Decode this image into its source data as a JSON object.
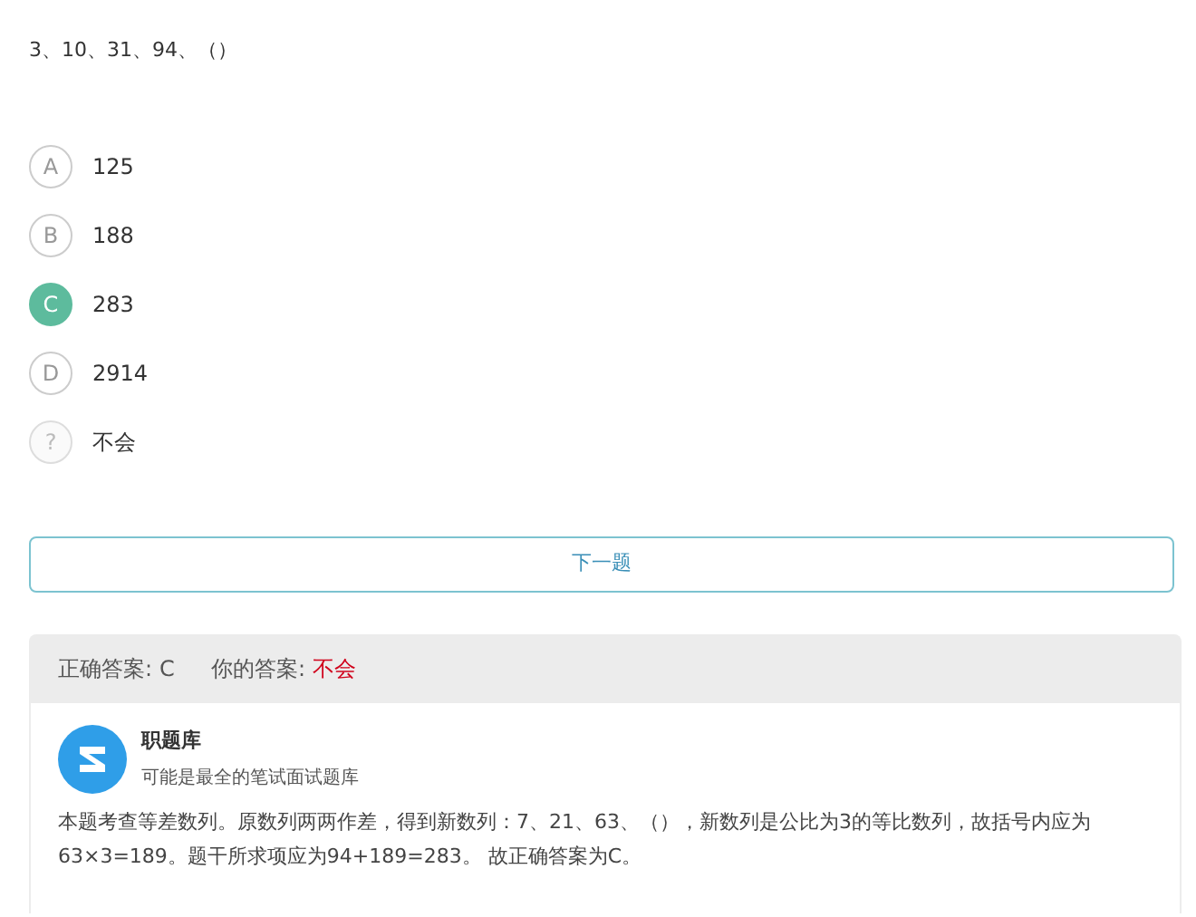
{
  "question": "3、10、31、94、（）",
  "options": [
    {
      "letter": "A",
      "text": "125",
      "selected": false,
      "kind": "choice"
    },
    {
      "letter": "B",
      "text": "188",
      "selected": false,
      "kind": "choice"
    },
    {
      "letter": "C",
      "text": "283",
      "selected": true,
      "kind": "choice"
    },
    {
      "letter": "D",
      "text": "2914",
      "selected": false,
      "kind": "choice"
    },
    {
      "letter": "?",
      "text": "不会",
      "selected": false,
      "kind": "unknown"
    }
  ],
  "next_button": "下一题",
  "result": {
    "correct_label": "正确答案:",
    "correct_value": "C",
    "yours_label": "你的答案:",
    "yours_value": "不会"
  },
  "source": {
    "name": "职题库",
    "tagline": "可能是最全的笔试面试题库"
  },
  "explanation": "本题考查等差数列。原数列两两作差，得到新数列：7、21、63、（），新数列是公比为3的等比数列，故括号内应为63×3=189。题干所求项应为94+189=283。 故正确答案为C。"
}
